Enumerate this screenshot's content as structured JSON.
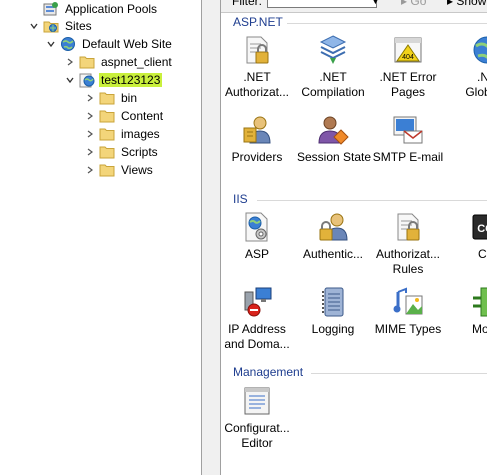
{
  "tree": {
    "items": [
      {
        "label": "Application Pools",
        "icon": "app-pools-icon"
      },
      {
        "label": "Sites",
        "icon": "sites-folder-icon"
      },
      {
        "label": "Default Web Site",
        "icon": "globe-icon"
      },
      {
        "label": "aspnet_client",
        "icon": "folder-icon"
      },
      {
        "label": "test123123",
        "icon": "web-app-icon"
      },
      {
        "label": "bin",
        "icon": "folder-icon"
      },
      {
        "label": "Content",
        "icon": "folder-icon"
      },
      {
        "label": "images",
        "icon": "folder-icon"
      },
      {
        "label": "Scripts",
        "icon": "folder-icon"
      },
      {
        "label": "Views",
        "icon": "folder-icon"
      }
    ]
  },
  "filterbar": {
    "filter_label": "Filter:",
    "go_label": "Go",
    "show_all_label": "Show"
  },
  "sections": {
    "aspnet": {
      "title": "ASP.NET",
      "features": [
        {
          "line1": ".NET",
          "line2": "Authorizat..."
        },
        {
          "line1": ".NET",
          "line2": "Compilation"
        },
        {
          "line1": ".NET Error",
          "line2": "Pages"
        },
        {
          "line1": ".NE",
          "line2": "Globaliz"
        },
        {
          "line1": "Providers",
          "line2": ""
        },
        {
          "line1": "Session State",
          "line2": ""
        },
        {
          "line1": "SMTP E-mail",
          "line2": ""
        }
      ]
    },
    "iis": {
      "title": "IIS",
      "features": [
        {
          "line1": "ASP",
          "line2": ""
        },
        {
          "line1": "Authentic...",
          "line2": ""
        },
        {
          "line1": "Authorizat...",
          "line2": "Rules"
        },
        {
          "line1": "CG",
          "line2": ""
        },
        {
          "line1": "IP Address",
          "line2": "and Doma..."
        },
        {
          "line1": "Logging",
          "line2": ""
        },
        {
          "line1": "MIME Types",
          "line2": ""
        },
        {
          "line1": "Modu",
          "line2": ""
        }
      ]
    },
    "management": {
      "title": "Management",
      "features": [
        {
          "line1": "Configurat...",
          "line2": "Editor"
        }
      ]
    }
  },
  "colors": {
    "selection": "#c9f03c",
    "section_header": "#1e3d8f",
    "folder": "#f3d57a"
  }
}
